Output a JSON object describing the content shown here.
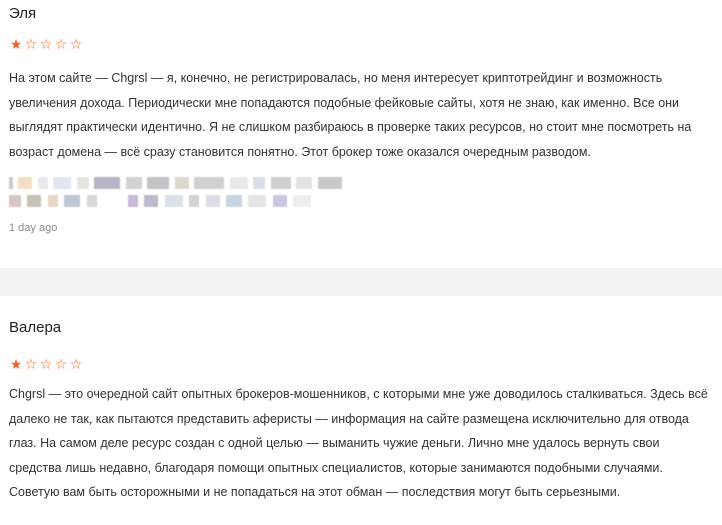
{
  "reviews": [
    {
      "author": "Эля",
      "rating": 1,
      "rating_max": 5,
      "text": "На этом сайте — Chgrsl — я, конечно, не регистрировалась, но меня интересует криптотрейдинг и возможность увеличения дохода. Периодически мне попадаются подобные фейковые сайты, хотя не знаю, как именно. Все они выглядят практически идентично. Я не слишком разбираюсь в проверке таких ресурсов, но стоит мне посмотреть на возраст домена — всё сразу становится понятно. Этот брокер тоже оказался очередным разводом.",
      "time": "1 day ago"
    },
    {
      "author": "Валера",
      "rating": 1,
      "rating_max": 5,
      "text": "Chgrsl — это очередной сайт опытных брокеров-мошенников, с которыми мне уже доводилось сталкиваться. Здесь всё далеко не так, как пытаются представить аферисты — информация на сайте размещена исключительно для отвода глаз. На самом деле ресурс создан с одной целью — выманить чужие деньги. Лично мне удалось вернуть свои средства лишь недавно, благодаря помощи опытных специалистов, которые занимаются подобными случаями. Советую вам быть осторожными и не попадаться на этот обман — последствия могут быть серьезными."
    }
  ],
  "icons": {
    "star_filled": "★",
    "star_empty": "☆"
  },
  "colors": {
    "star": "#f0612d",
    "band": "#f2f3f5"
  }
}
